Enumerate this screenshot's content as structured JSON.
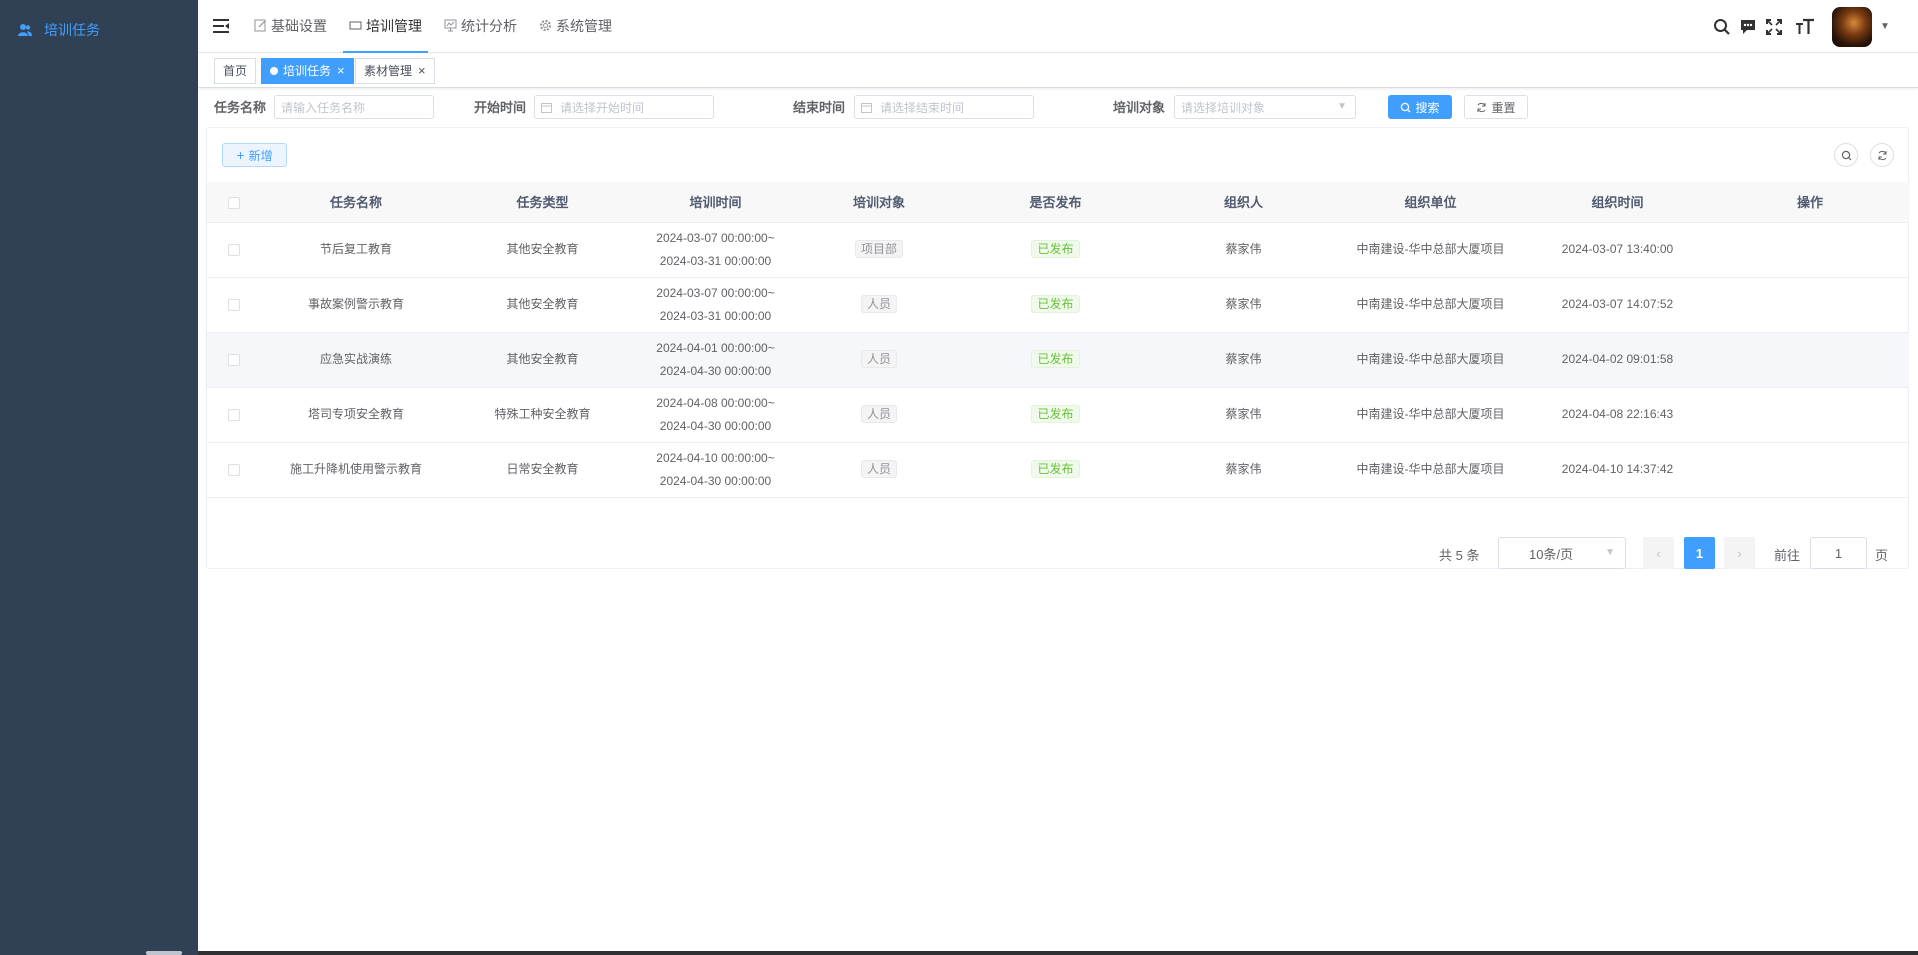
{
  "sidebar": {
    "items": [
      {
        "label": "培训任务",
        "icon": "users-icon",
        "active": true
      }
    ]
  },
  "topnav": {
    "items": [
      {
        "label": "基础设置",
        "icon": "edit-icon"
      },
      {
        "label": "培训管理",
        "icon": "monitor-icon",
        "active": true
      },
      {
        "label": "统计分析",
        "icon": "chart-icon"
      },
      {
        "label": "系统管理",
        "icon": "gear-icon"
      }
    ]
  },
  "tags": [
    {
      "label": "首页"
    },
    {
      "label": "培训任务",
      "active": true
    },
    {
      "label": "素材管理"
    }
  ],
  "search": {
    "name_label": "任务名称",
    "name_placeholder": "请输入任务名称",
    "start_label": "开始时间",
    "start_placeholder": "请选择开始时间",
    "end_label": "结束时间",
    "end_placeholder": "请选择结束时间",
    "target_label": "培训对象",
    "target_placeholder": "请选择培训对象",
    "search_btn": "搜索",
    "reset_btn": "重置"
  },
  "toolbar": {
    "add_btn": "新增"
  },
  "table": {
    "headers": [
      "任务名称",
      "任务类型",
      "培训时间",
      "培训对象",
      "是否发布",
      "组织人",
      "组织单位",
      "组织时间",
      "操作"
    ],
    "rows": [
      {
        "name": "节后复工教育",
        "type": "其他安全教育",
        "time_start": "2024-03-07 00:00:00~",
        "time_end": "2024-03-31 00:00:00",
        "target": "项目部",
        "published": "已发布",
        "organizer": "蔡家伟",
        "unit": "中南建设-华中总部大厦项目",
        "org_time": "2024-03-07 13:40:00"
      },
      {
        "name": "事故案例警示教育",
        "type": "其他安全教育",
        "time_start": "2024-03-07 00:00:00~",
        "time_end": "2024-03-31 00:00:00",
        "target": "人员",
        "published": "已发布",
        "organizer": "蔡家伟",
        "unit": "中南建设-华中总部大厦项目",
        "org_time": "2024-03-07 14:07:52"
      },
      {
        "name": "应急实战演练",
        "type": "其他安全教育",
        "time_start": "2024-04-01 00:00:00~",
        "time_end": "2024-04-30 00:00:00",
        "target": "人员",
        "published": "已发布",
        "organizer": "蔡家伟",
        "unit": "中南建设-华中总部大厦项目",
        "org_time": "2024-04-02 09:01:58"
      },
      {
        "name": "塔司专项安全教育",
        "type": "特殊工种安全教育",
        "time_start": "2024-04-08 00:00:00~",
        "time_end": "2024-04-30 00:00:00",
        "target": "人员",
        "published": "已发布",
        "organizer": "蔡家伟",
        "unit": "中南建设-华中总部大厦项目",
        "org_time": "2024-04-08 22:16:43"
      },
      {
        "name": "施工升降机使用警示教育",
        "type": "日常安全教育",
        "time_start": "2024-04-10 00:00:00~",
        "time_end": "2024-04-30 00:00:00",
        "target": "人员",
        "published": "已发布",
        "organizer": "蔡家伟",
        "unit": "中南建设-华中总部大厦项目",
        "org_time": "2024-04-10 14:37:42"
      }
    ]
  },
  "pagination": {
    "total": "共 5 条",
    "page_size": "10条/页",
    "current": "1",
    "goto_label": "前往",
    "goto_value": "1",
    "unit": "页"
  },
  "colors": {
    "primary": "#409eff",
    "sidebar": "#304156",
    "success": "#67c23a"
  }
}
